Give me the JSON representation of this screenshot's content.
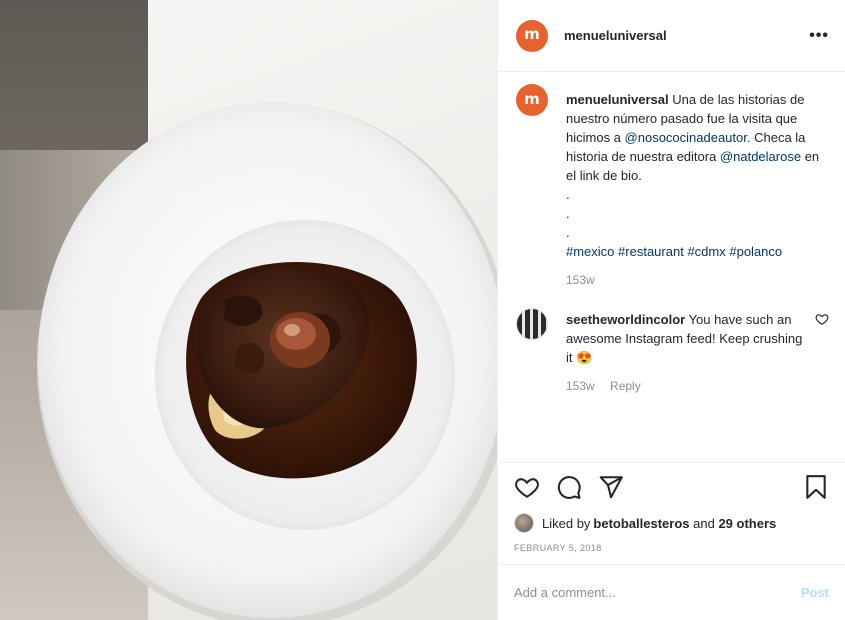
{
  "post_header": {
    "username": "menueluniversal",
    "more_label": "•••",
    "logo_letter": "m"
  },
  "caption": {
    "username": "menueluniversal",
    "text_1": " Una de las historias de nuestro número pasado fue la visita que hicimos a ",
    "mention_1": "@nosococinadeautor",
    "text_2": ". Checa la historia de nuestra editora ",
    "mention_2": "@natdelarose",
    "text_3": " en el link de bio.",
    "dots": [
      ".",
      ".",
      "."
    ],
    "hashtags": [
      "#mexico",
      "#restaurant",
      "#cdmx",
      "#polanco"
    ],
    "time": "153w"
  },
  "comment": {
    "username": "seetheworldincolor",
    "text": " You have such an awesome Instagram feed! Keep crushing it ",
    "emoji": "😍",
    "time": "153w",
    "reply_label": "Reply"
  },
  "actions": {
    "liked_prefix": "Liked by ",
    "liked_user": "betoballesteros",
    "liked_and": " and ",
    "liked_others": "29 others",
    "date": "FEBRUARY 5, 2018"
  },
  "add_comment": {
    "placeholder": "Add a comment...",
    "post_label": "Post"
  },
  "colors": {
    "brand": "#e8622d",
    "link": "#00376b",
    "muted": "#8e8e8e",
    "post_disabled": "#b2dffc"
  }
}
